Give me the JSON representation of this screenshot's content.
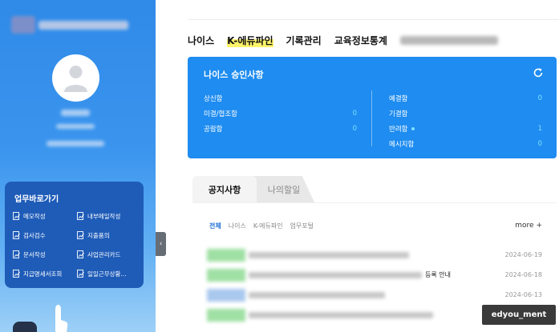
{
  "topnav": {
    "items": [
      "나이스",
      "K-에듀파인",
      "기록관리",
      "교육정보통계"
    ]
  },
  "approval": {
    "title": "나이스 승인사항",
    "left": [
      {
        "label": "상신함",
        "value": ""
      },
      {
        "label": "미결/협조함",
        "value": "0"
      },
      {
        "label": "공람함",
        "value": "0"
      }
    ],
    "right": [
      {
        "label": "예결함",
        "value": "0"
      },
      {
        "label": "기결함",
        "value": ""
      },
      {
        "label": "반려함",
        "value": "1"
      },
      {
        "label": "메시지함",
        "value": "0"
      }
    ]
  },
  "quick_links": {
    "title": "업무바로가기",
    "items": [
      "메모작성",
      "내부메일작성",
      "검사검수",
      "지출품의",
      "문서작성",
      "사업관리카드",
      "지급명세서조회",
      "일일근무상황..."
    ]
  },
  "tabs": [
    "공지사항",
    "나의할일"
  ],
  "notice": {
    "subtabs": [
      "전체",
      "나이스",
      "K-에듀파인",
      "업무포털"
    ],
    "more": "more +",
    "rows": [
      {
        "text": "",
        "date": "2024-06-19"
      },
      {
        "text": "등록 안내",
        "date": "2024-06-18"
      },
      {
        "text": "",
        "date": "2024-06-13"
      },
      {
        "text": "",
        "date": ""
      }
    ]
  },
  "watermark": "edyou_ment",
  "colors": {
    "sidebar": "#2f8ae8",
    "approval_card": "#1e8cf0",
    "quick_panel": "#1f5cb8",
    "value_cyan": "#7fe2ff",
    "active_subtab": "#1e6fd6",
    "highlight": "#fff46a"
  }
}
